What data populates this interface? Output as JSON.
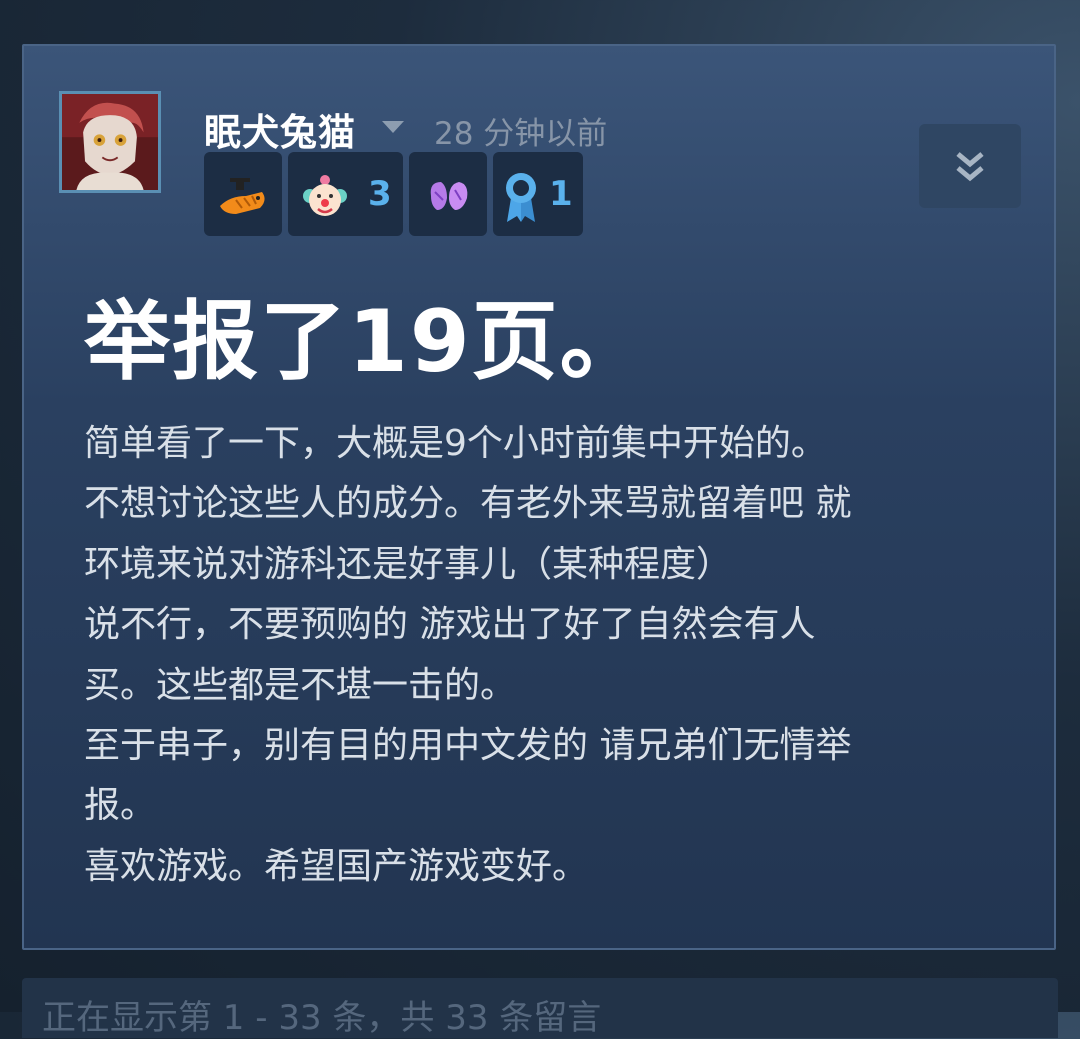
{
  "post": {
    "author": "眠犬兔猫",
    "timestamp": "28 分钟以前",
    "badges": [
      {
        "icon": "orange-graduate-dino-icon",
        "count": ""
      },
      {
        "icon": "clown-face-icon",
        "count": "3"
      },
      {
        "icon": "clapping-hands-icon",
        "count": ""
      },
      {
        "icon": "award-ribbon-icon",
        "count": "1"
      }
    ],
    "title": "举报了19页。",
    "body_lines": [
      "简单看了一下，大概是9个小时前集中开始的。",
      "不想讨论这些人的成分。有老外来骂就留着吧 就",
      "环境来说对游科还是好事儿（某种程度）",
      "说不行，不要预购的 游戏出了好了自然会有人",
      "买。这些都是不堪一击的。",
      "至于串子，别有目的用中文发的 请兄弟们无情举",
      "报。",
      "喜欢游戏。希望国产游戏变好。"
    ]
  },
  "footer": {
    "status": "正在显示第 1 - 33 条，共 33 条留言"
  },
  "colors": {
    "card_top": "#3b5579",
    "card_bottom": "#223551",
    "badge_count": "#5ab1ec",
    "timestamp": "#8795a8"
  }
}
